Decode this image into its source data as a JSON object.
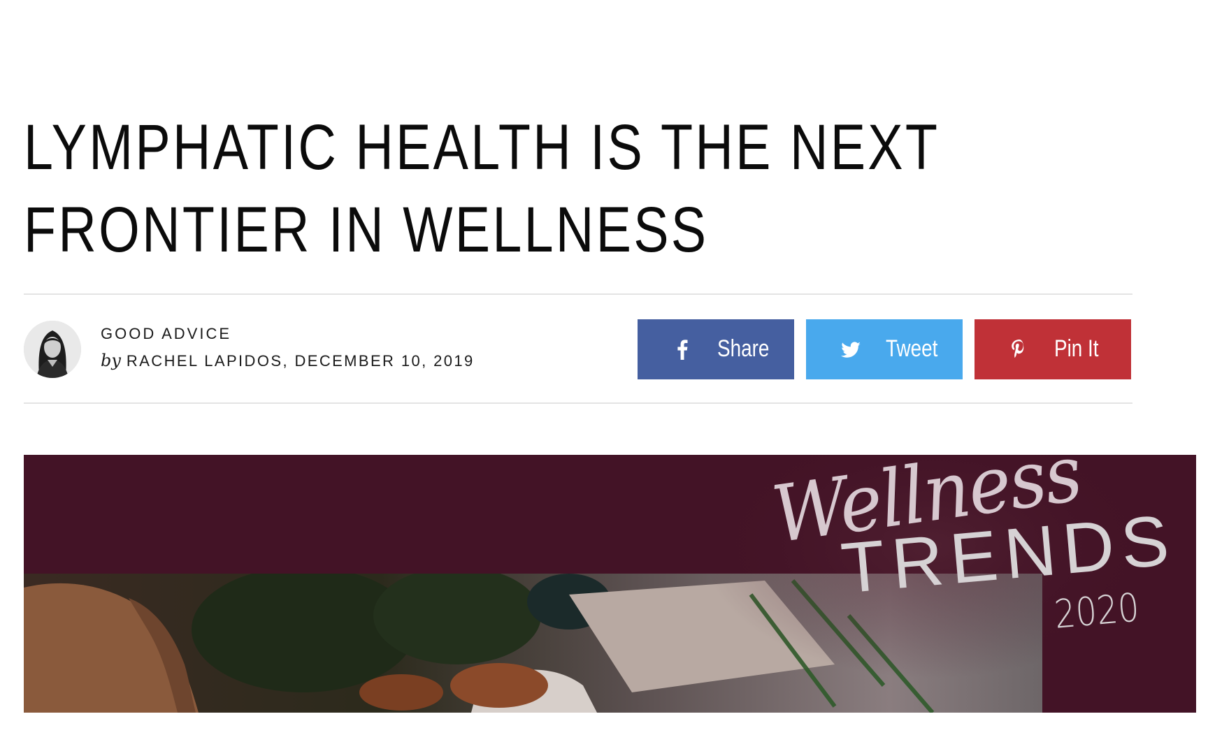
{
  "article": {
    "headline": "LYMPHATIC HEALTH IS THE NEXT FRONTIER IN WELLNESS",
    "category": "GOOD ADVICE",
    "by_label": "by",
    "author": "RACHEL LAPIDOS",
    "date": ", DECEMBER 10, 2019"
  },
  "share": {
    "facebook_label": "Share",
    "twitter_label": "Tweet",
    "pinterest_label": "Pin It"
  },
  "hero": {
    "script_text": "Wellness",
    "trends_text": "TRENDS",
    "year_text": "2020"
  },
  "colors": {
    "facebook": "#455fa0",
    "twitter": "#49a9ed",
    "pinterest": "#c03137",
    "hero_banner": "#431326"
  },
  "icons": {
    "facebook": "facebook-icon",
    "twitter": "twitter-icon",
    "pinterest": "pinterest-icon"
  }
}
